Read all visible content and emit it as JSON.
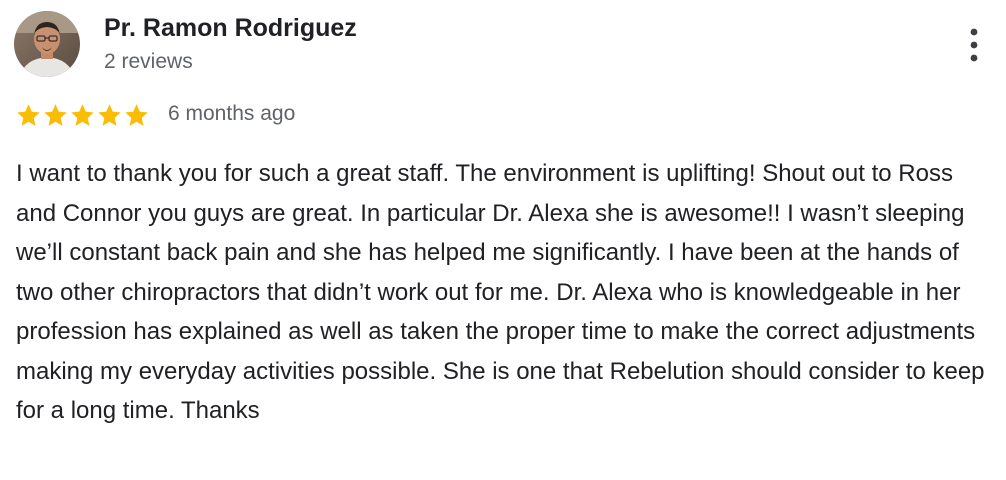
{
  "reviewer": {
    "name": "Pr. Ramon Rodriguez",
    "review_count": "2 reviews",
    "avatar_icon": "user-photo-avatar"
  },
  "review": {
    "rating": 5,
    "rating_max": 5,
    "date": "6 months ago",
    "text": "I want to thank you for such a great staff. The environment is uplifting! Shout out to Ross and Connor you guys are great. In particular Dr. Alexa she is awesome!! I wasn’t sleeping we’ll constant back pain and she has helped me significantly. I have been at the hands of two other chiropractors that didn’t work out for me. Dr. Alexa who is knowledgeable in her profession has explained as well as taken the proper time to make the correct adjustments making my everyday activities possible. She is one that Rebelution should consider to keep for a long time. Thanks"
  },
  "menu": {
    "icon": "more-vertical-icon"
  },
  "colors": {
    "star": "#fbbc04",
    "text_primary": "#202124",
    "text_secondary": "#5f6368"
  }
}
